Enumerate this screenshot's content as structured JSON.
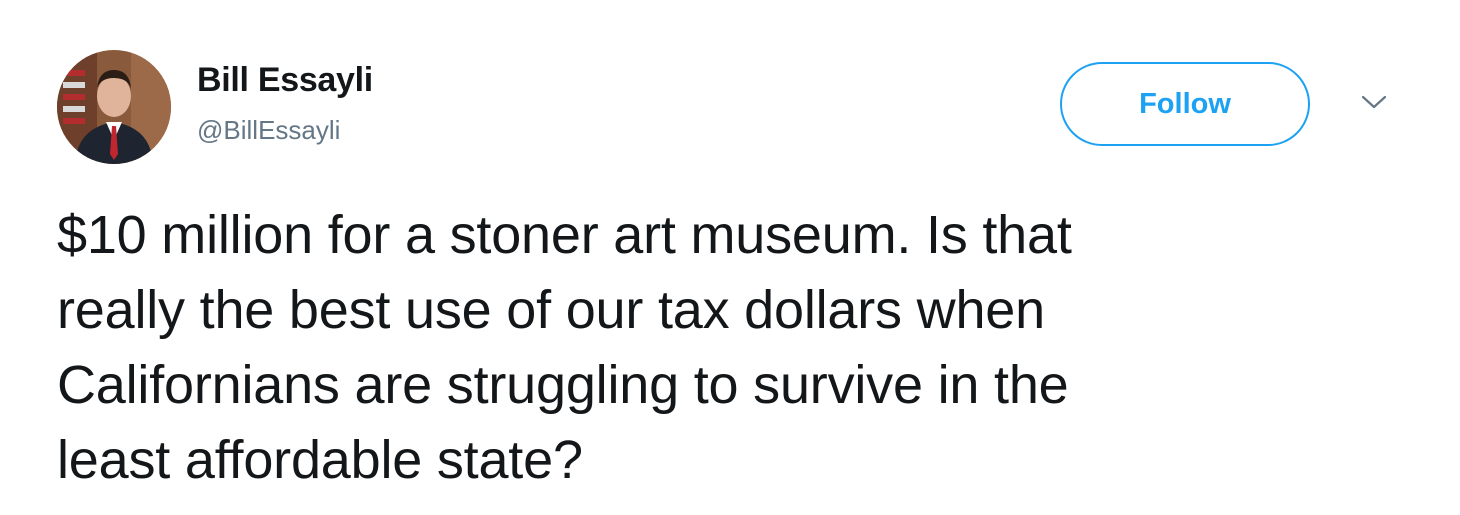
{
  "user": {
    "display_name": "Bill Essayli",
    "handle": "@BillEssayli"
  },
  "follow_button": {
    "label": "Follow"
  },
  "tweet": {
    "lines": [
      "$10 million for a stoner art museum. Is that",
      "really the best use of our tax dollars when",
      "Californians are struggling to survive in the",
      "least affordable state?"
    ]
  },
  "icons": {
    "menu": "chevron-down-icon",
    "avatar": "avatar"
  },
  "colors": {
    "accent": "#1da1f2",
    "text": "#14171a",
    "secondary_text": "#657786"
  }
}
